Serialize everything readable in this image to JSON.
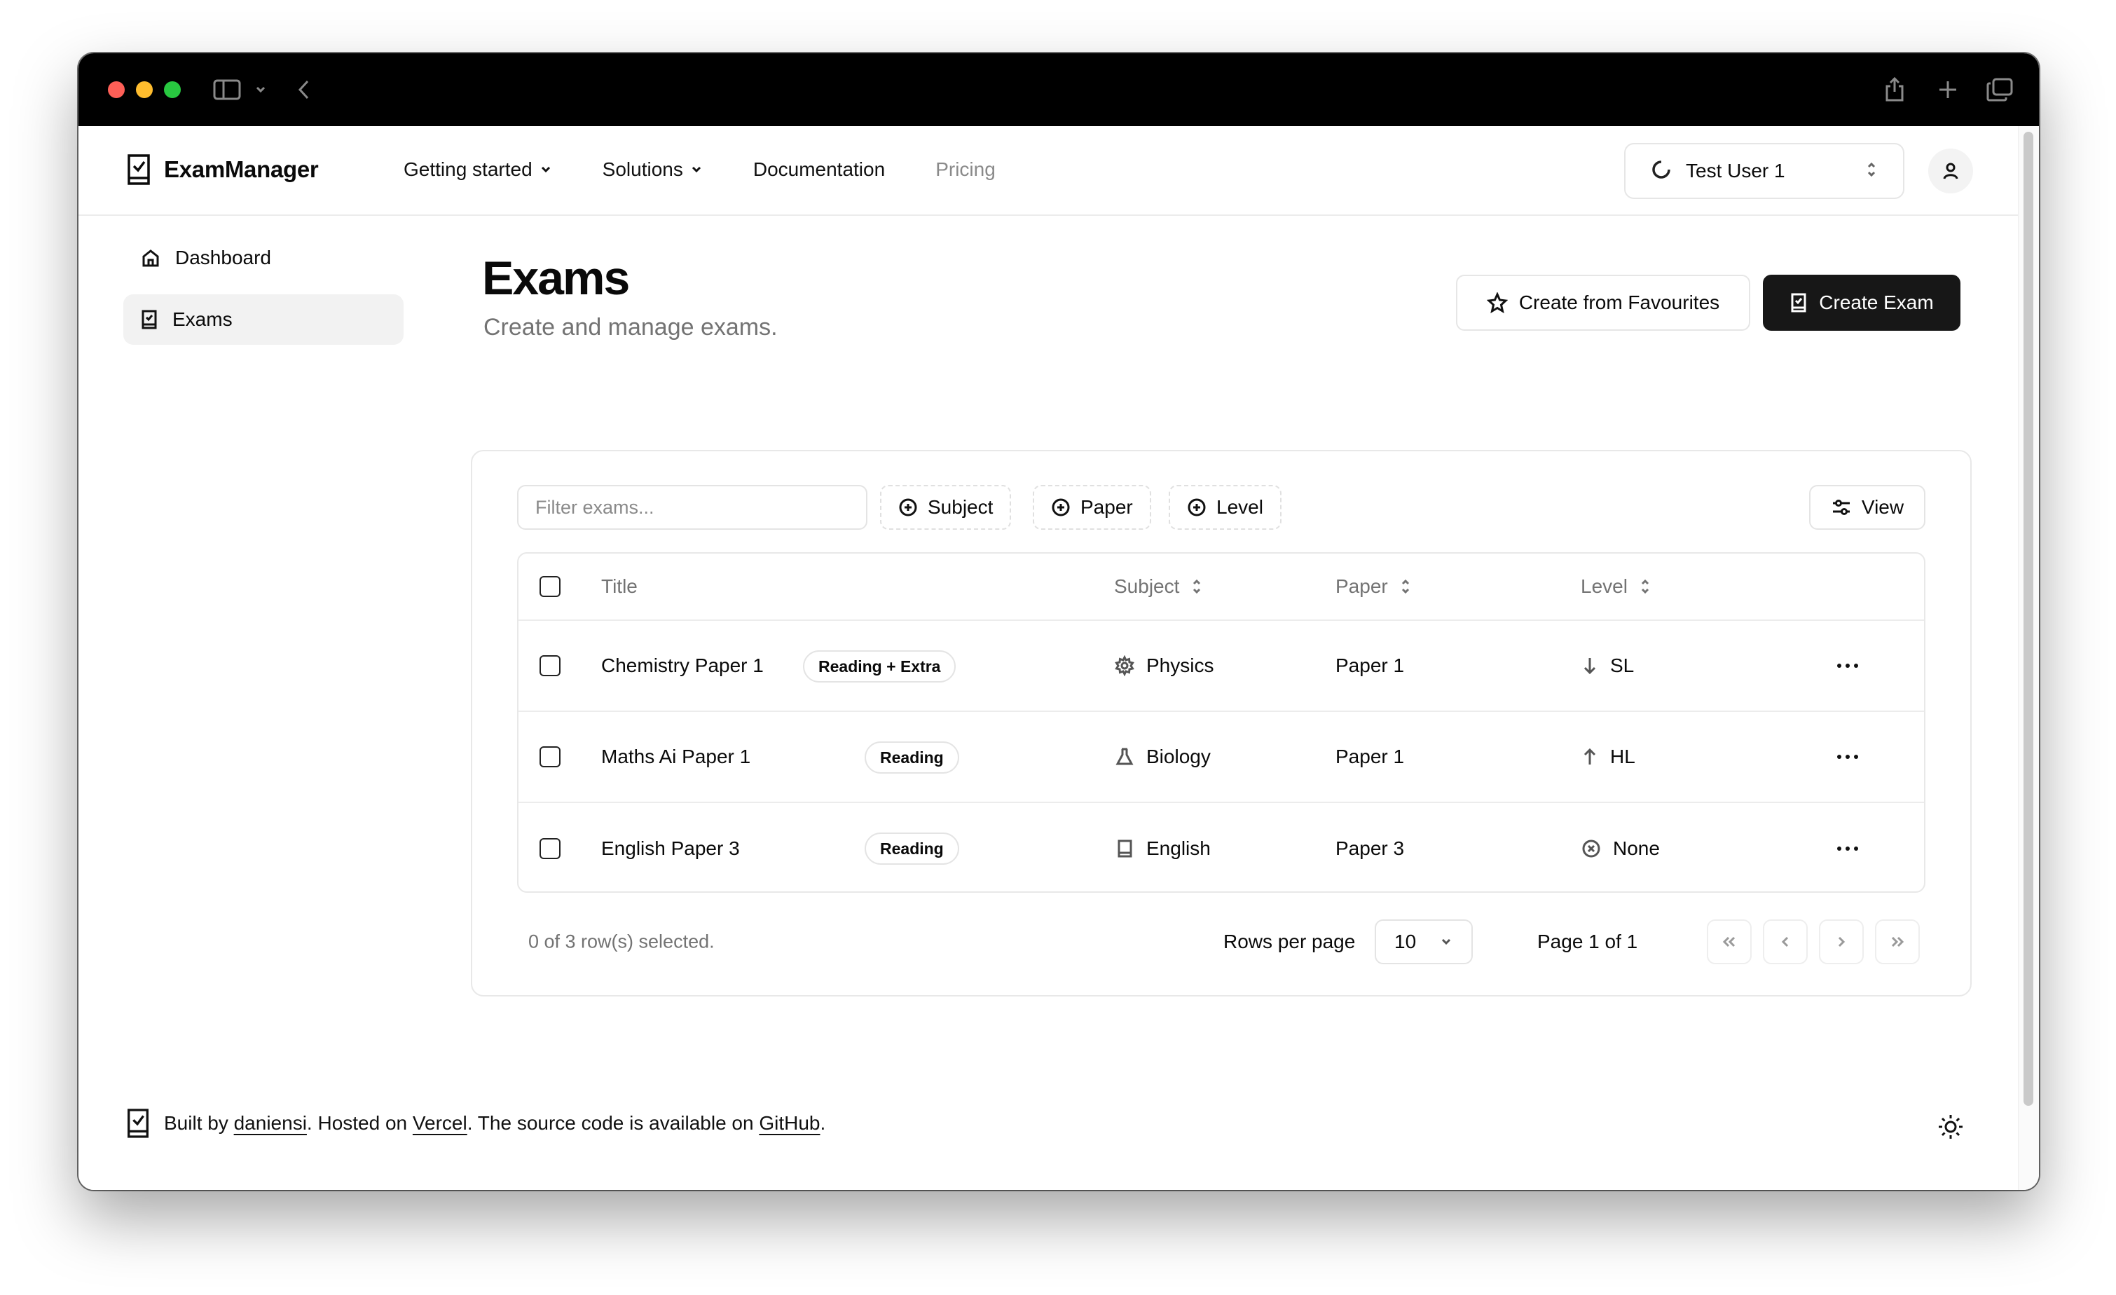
{
  "app": {
    "name": "ExamManager"
  },
  "nav": [
    {
      "label": "Getting started",
      "has_menu": true
    },
    {
      "label": "Solutions",
      "has_menu": true
    },
    {
      "label": "Documentation",
      "has_menu": false
    },
    {
      "label": "Pricing",
      "has_menu": false,
      "muted": true
    }
  ],
  "user": {
    "name": "Test User 1"
  },
  "sidebar": {
    "items": [
      {
        "label": "Dashboard",
        "icon": "home-icon",
        "active": false
      },
      {
        "label": "Exams",
        "icon": "exam-icon",
        "active": true
      }
    ]
  },
  "page": {
    "title": "Exams",
    "subtitle": "Create and manage exams.",
    "actions": {
      "favourites_label": "Create from Favourites",
      "create_label": "Create Exam"
    }
  },
  "toolbar": {
    "filter_placeholder": "Filter exams...",
    "facets": [
      "Subject",
      "Paper",
      "Level"
    ],
    "view_label": "View"
  },
  "table": {
    "columns": [
      "Title",
      "Subject",
      "Paper",
      "Level"
    ],
    "rows": [
      {
        "title": "Chemistry Paper 1",
        "badge": "Reading + Extra",
        "subject": "Physics",
        "subject_icon": "gear-icon",
        "paper": "Paper 1",
        "level": "SL",
        "level_icon": "arrow-down-icon"
      },
      {
        "title": "Maths Ai Paper 1",
        "badge": "Reading",
        "subject": "Biology",
        "subject_icon": "flask-icon",
        "paper": "Paper 1",
        "level": "HL",
        "level_icon": "arrow-up-icon"
      },
      {
        "title": "English Paper 3",
        "badge": "Reading",
        "subject": "English",
        "subject_icon": "book-icon",
        "paper": "Paper 3",
        "level": "None",
        "level_icon": "circle-x-icon"
      }
    ]
  },
  "pagination": {
    "selection_text": "0 of 3 row(s) selected.",
    "rows_per_page_label": "Rows per page",
    "rows_per_page_value": "10",
    "page_text": "Page 1 of 1"
  },
  "footer": {
    "prefix": "Built by",
    "author": "daniensi",
    "hosted_text": ". Hosted on",
    "host": "Vercel",
    "source_text": ". The source code is available on",
    "repo": "GitHub",
    "suffix": "."
  },
  "colors": {
    "primary": "#171717",
    "muted_text": "#737373",
    "border": "#e6e6e6",
    "traffic_red": "#fe5f57",
    "traffic_yellow": "#febc2e",
    "traffic_green": "#28c840"
  }
}
